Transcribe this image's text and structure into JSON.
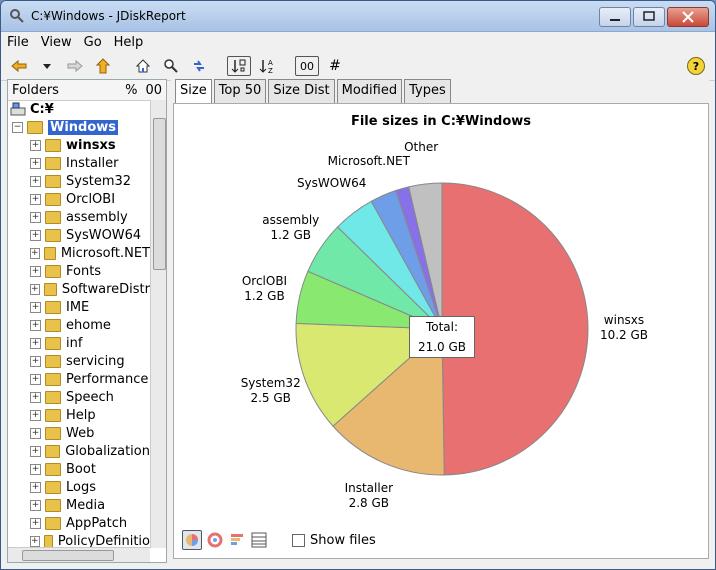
{
  "window": {
    "title": "C:¥Windows - JDiskReport"
  },
  "menu": [
    {
      "label": "File"
    },
    {
      "label": "View"
    },
    {
      "label": "Go"
    },
    {
      "label": "Help"
    }
  ],
  "toolbar": {
    "hash_label": "#",
    "boxed_label": "00"
  },
  "tree_panel": {
    "header": "Folders",
    "col_percent": "%",
    "col_size": "00",
    "root": "C:¥",
    "selected": "Windows",
    "items": [
      {
        "label": "winsxs",
        "bold": true
      },
      {
        "label": "Installer"
      },
      {
        "label": "System32"
      },
      {
        "label": "OrclOBI"
      },
      {
        "label": "assembly"
      },
      {
        "label": "SysWOW64"
      },
      {
        "label": "Microsoft.NET"
      },
      {
        "label": "Fonts"
      },
      {
        "label": "SoftwareDistr"
      },
      {
        "label": "IME"
      },
      {
        "label": "ehome"
      },
      {
        "label": "inf"
      },
      {
        "label": "servicing"
      },
      {
        "label": "Performance"
      },
      {
        "label": "Speech"
      },
      {
        "label": "Help"
      },
      {
        "label": "Web"
      },
      {
        "label": "Globalization"
      },
      {
        "label": "Boot"
      },
      {
        "label": "Logs"
      },
      {
        "label": "Media"
      },
      {
        "label": "AppPatch"
      },
      {
        "label": "PolicyDefinitio"
      }
    ]
  },
  "tabs": [
    "Size",
    "Top 50",
    "Size Dist",
    "Modified",
    "Types"
  ],
  "active_tab": "Size",
  "chart_data": {
    "type": "pie",
    "title": "File sizes in C:¥Windows",
    "total_label": "Total:",
    "total_value": "21.0 GB",
    "slices": [
      {
        "name": "winsxs",
        "value": 10.2,
        "size_label": "10.2 GB",
        "color": "#e87070"
      },
      {
        "name": "Installer",
        "value": 2.8,
        "size_label": "2.8 GB",
        "color": "#e8b870"
      },
      {
        "name": "System32",
        "value": 2.5,
        "size_label": "2.5 GB",
        "color": "#d8e870"
      },
      {
        "name": "OrclOBI",
        "value": 1.2,
        "size_label": "1.2 GB",
        "color": "#88e870"
      },
      {
        "name": "assembly",
        "value": 1.2,
        "size_label": "1.2 GB",
        "color": "#70e8a8"
      },
      {
        "name": "SysWOW64",
        "value": 0.95,
        "size_label": "",
        "color": "#70e8e8"
      },
      {
        "name": "Microsoft.NET",
        "value": 0.6,
        "size_label": "",
        "color": "#6f9ee8"
      },
      {
        "name": "",
        "value": 0.3,
        "size_label": "",
        "color": "#8870e8"
      },
      {
        "name": "Other",
        "value": 0.75,
        "size_label": "",
        "color": "#c0c0c0"
      }
    ]
  },
  "bottom": {
    "show_files_label": "Show files"
  }
}
